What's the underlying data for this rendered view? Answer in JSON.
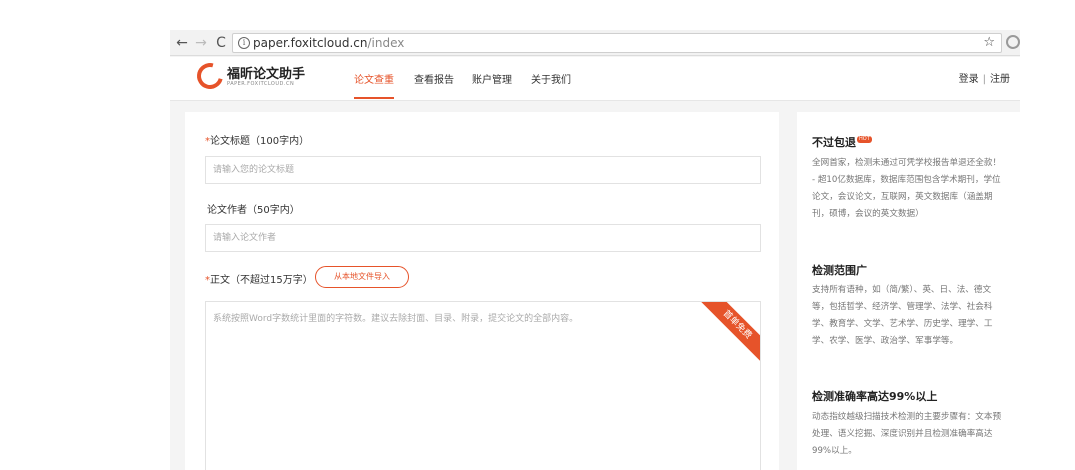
{
  "browser": {
    "url_host": "paper.foxitcloud.cn",
    "url_path": "/index",
    "back_icon": "←",
    "forward_icon": "→",
    "reload_icon": "C",
    "info_icon": "i",
    "star_icon": "☆"
  },
  "header": {
    "logo_name": "福昕论文助手",
    "logo_sub": "PAPER.FOXITCLOUD.CN",
    "nav": [
      {
        "label": "论文查重"
      },
      {
        "label": "查看报告"
      },
      {
        "label": "账户管理"
      },
      {
        "label": "关于我们"
      }
    ],
    "login": "登录",
    "separator": "|",
    "register": "注册"
  },
  "form": {
    "required_mark": "*",
    "title_label": "论文标题（100字内）",
    "title_placeholder": "请输入您的论文标题",
    "author_label": "论文作者（50字内）",
    "author_placeholder": "请输入论文作者",
    "body_label": "正文（不超过15万字）",
    "import_button": "从本地文件导入",
    "body_placeholder": "系统按照Word字数统计里面的字符数。建议去除封面、目录、附录，提交论文的全部内容。",
    "ribbon": "首单免费"
  },
  "side": {
    "s1_title": "不过包退",
    "hot_badge": "HOT",
    "s1_text": "全网首家，检测未通过可凭学校报告单退还全款！\n- 超10亿数据库，数据库范围包含学术期刊，学位论文，会议论文，互联网，英文数据库（涵盖期刊，硕博，会议的英文数据）",
    "s2_title": "检测范围广",
    "s2_text": "支持所有语种，如（简/繁）、英、日、法、德文等，包括哲学、经济学、管理学、法学、社会科学、教育学、文学、艺术学、历史学、理学、工学、农学、医学、政治学、军事学等。",
    "s3_title": "检测准确率高达99%以上",
    "s3_text": "动态指纹越级扫描技术检测的主要步骤有：文本预处理、语义挖掘、深度识别并且检测准确率高达99%以上。"
  },
  "colors": {
    "accent": "#e6532a"
  }
}
